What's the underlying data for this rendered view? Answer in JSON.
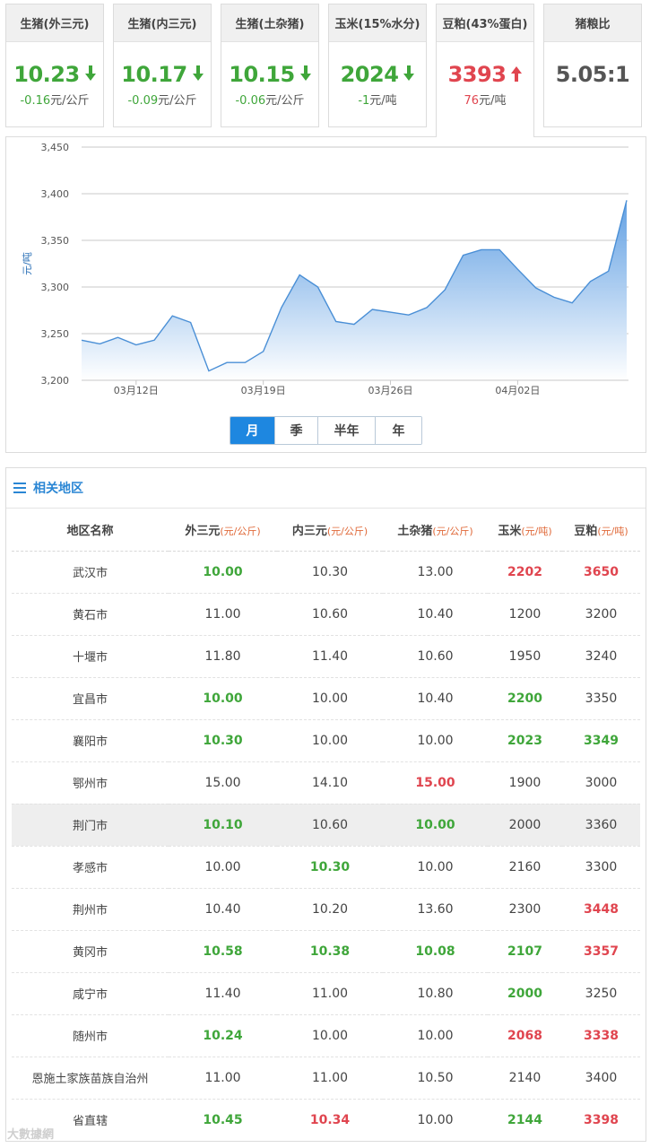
{
  "cards": [
    {
      "title": "生猪(外三元)",
      "price": "10.23",
      "direction": "down",
      "change": "-0.16",
      "unit": "元/公斤"
    },
    {
      "title": "生猪(内三元)",
      "price": "10.17",
      "direction": "down",
      "change": "-0.09",
      "unit": "元/公斤"
    },
    {
      "title": "生猪(土杂猪)",
      "price": "10.15",
      "direction": "down",
      "change": "-0.06",
      "unit": "元/公斤"
    },
    {
      "title": "玉米(15%水分)",
      "price": "2024",
      "direction": "down",
      "change": "-1",
      "unit": "元/吨"
    },
    {
      "title": "豆粕(43%蛋白)",
      "price": "3393",
      "direction": "up",
      "change": "76",
      "unit": "元/吨"
    },
    {
      "title": "猪粮比",
      "price": "5.05:1",
      "direction": "none",
      "change": "",
      "unit": ""
    }
  ],
  "chart_data": {
    "type": "area",
    "ylabel": "元/吨",
    "ylim": [
      3200,
      3450
    ],
    "yticks": [
      "3,200",
      "3,250",
      "3,300",
      "3,350",
      "3,400",
      "3,450"
    ],
    "ytick_values": [
      3200,
      3250,
      3300,
      3350,
      3400,
      3450
    ],
    "xticks": [
      {
        "label": "03月12日",
        "index": 3
      },
      {
        "label": "03月19日",
        "index": 10
      },
      {
        "label": "03月26日",
        "index": 17
      },
      {
        "label": "04月02日",
        "index": 24
      }
    ],
    "x": [
      "03月09日",
      "03月10日",
      "03月11日",
      "03月12日",
      "03月13日",
      "03月14日",
      "03月15日",
      "03月16日",
      "03月17日",
      "03月18日",
      "03月19日",
      "03月20日",
      "03月21日",
      "03月22日",
      "03月23日",
      "03月24日",
      "03月25日",
      "03月26日",
      "03月27日",
      "03月28日",
      "03月29日",
      "03月30日",
      "03月31日",
      "04月01日",
      "04月02日",
      "04月03日",
      "04月04日",
      "04月05日",
      "04月06日",
      "04月07日",
      "04月08日"
    ],
    "series": [
      {
        "values": [
          3243,
          3239,
          3246,
          3238,
          3243,
          3269,
          3262,
          3210,
          3219,
          3219,
          3231,
          3278,
          3313,
          3300,
          3263,
          3260,
          3276,
          3273,
          3270,
          3278,
          3297,
          3334,
          3340,
          3340,
          3319,
          3299,
          3289,
          3283,
          3306,
          3317,
          3393
        ]
      }
    ],
    "grid": true,
    "colors": {
      "line": "#4a8fd6",
      "fill_top": "#5b9ce2",
      "fill_bottom": "#ffffff",
      "grid": "#c8c8c8"
    }
  },
  "periods": {
    "items": [
      "月",
      "季",
      "半年",
      "年"
    ],
    "active": "月"
  },
  "region": {
    "title": "相关地区",
    "headers": [
      {
        "label": "地区名称",
        "unit": ""
      },
      {
        "label": "外三元",
        "unit": "(元/公斤)"
      },
      {
        "label": "内三元",
        "unit": "(元/公斤)"
      },
      {
        "label": "土杂猪",
        "unit": "(元/公斤)"
      },
      {
        "label": "玉米",
        "unit": "(元/吨)"
      },
      {
        "label": "豆粕",
        "unit": "(元/吨)"
      }
    ],
    "rows": [
      {
        "name": "武汉市",
        "cells": [
          [
            "10.00",
            "g"
          ],
          [
            "10.30",
            "n"
          ],
          [
            "13.00",
            "n"
          ],
          [
            "2202",
            "r"
          ],
          [
            "3650",
            "r"
          ]
        ]
      },
      {
        "name": "黄石市",
        "cells": [
          [
            "11.00",
            "n"
          ],
          [
            "10.60",
            "n"
          ],
          [
            "10.40",
            "n"
          ],
          [
            "1200",
            "n"
          ],
          [
            "3200",
            "n"
          ]
        ]
      },
      {
        "name": "十堰市",
        "cells": [
          [
            "11.80",
            "n"
          ],
          [
            "11.40",
            "n"
          ],
          [
            "10.60",
            "n"
          ],
          [
            "1950",
            "n"
          ],
          [
            "3240",
            "n"
          ]
        ]
      },
      {
        "name": "宜昌市",
        "cells": [
          [
            "10.00",
            "g"
          ],
          [
            "10.00",
            "n"
          ],
          [
            "10.40",
            "n"
          ],
          [
            "2200",
            "g"
          ],
          [
            "3350",
            "n"
          ]
        ]
      },
      {
        "name": "襄阳市",
        "cells": [
          [
            "10.30",
            "g"
          ],
          [
            "10.00",
            "n"
          ],
          [
            "10.00",
            "n"
          ],
          [
            "2023",
            "g"
          ],
          [
            "3349",
            "g"
          ]
        ]
      },
      {
        "name": "鄂州市",
        "cells": [
          [
            "15.00",
            "n"
          ],
          [
            "14.10",
            "n"
          ],
          [
            "15.00",
            "r"
          ],
          [
            "1900",
            "n"
          ],
          [
            "3000",
            "n"
          ]
        ]
      },
      {
        "name": "荆门市",
        "cells": [
          [
            "10.10",
            "g"
          ],
          [
            "10.60",
            "n"
          ],
          [
            "10.00",
            "g"
          ],
          [
            "2000",
            "n"
          ],
          [
            "3360",
            "n"
          ]
        ],
        "highlight": true
      },
      {
        "name": "孝感市",
        "cells": [
          [
            "10.00",
            "n"
          ],
          [
            "10.30",
            "g"
          ],
          [
            "10.00",
            "n"
          ],
          [
            "2160",
            "n"
          ],
          [
            "3300",
            "n"
          ]
        ]
      },
      {
        "name": "荆州市",
        "cells": [
          [
            "10.40",
            "n"
          ],
          [
            "10.20",
            "n"
          ],
          [
            "13.60",
            "n"
          ],
          [
            "2300",
            "n"
          ],
          [
            "3448",
            "r"
          ]
        ]
      },
      {
        "name": "黄冈市",
        "cells": [
          [
            "10.58",
            "g"
          ],
          [
            "10.38",
            "g"
          ],
          [
            "10.08",
            "g"
          ],
          [
            "2107",
            "g"
          ],
          [
            "3357",
            "r"
          ]
        ]
      },
      {
        "name": "咸宁市",
        "cells": [
          [
            "11.40",
            "n"
          ],
          [
            "11.00",
            "n"
          ],
          [
            "10.80",
            "n"
          ],
          [
            "2000",
            "g"
          ],
          [
            "3250",
            "n"
          ]
        ]
      },
      {
        "name": "随州市",
        "cells": [
          [
            "10.24",
            "g"
          ],
          [
            "10.00",
            "n"
          ],
          [
            "10.00",
            "n"
          ],
          [
            "2068",
            "r"
          ],
          [
            "3338",
            "r"
          ]
        ]
      },
      {
        "name": "恩施土家族苗族自治州",
        "cells": [
          [
            "11.00",
            "n"
          ],
          [
            "11.00",
            "n"
          ],
          [
            "10.50",
            "n"
          ],
          [
            "2140",
            "n"
          ],
          [
            "3400",
            "n"
          ]
        ]
      },
      {
        "name": "省直辖",
        "cells": [
          [
            "10.45",
            "g"
          ],
          [
            "10.34",
            "r"
          ],
          [
            "10.00",
            "n"
          ],
          [
            "2144",
            "g"
          ],
          [
            "3398",
            "r"
          ]
        ]
      }
    ]
  },
  "watermark": "大數據網"
}
